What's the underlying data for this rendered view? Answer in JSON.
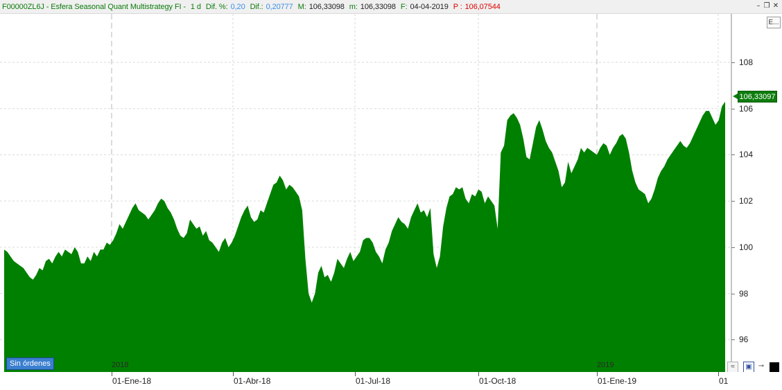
{
  "title_bar": {
    "instrument": "F00000ZL6J - Esfera Seasonal Quant Multistrategy FI -",
    "period": "1 d",
    "dif_pct_label": "Dif. %:",
    "dif_pct_value": "0,20",
    "dif_label": "Dif.:",
    "dif_value": "0,20777",
    "max_label": "M:",
    "max_value": "106,33098",
    "min_label": "m:",
    "min_value": "106,33098",
    "date_label": "F:",
    "date_value": "04-04-2019",
    "p_label": "P :",
    "p_value": "106,07544"
  },
  "window_controls": {
    "minimize": "–",
    "restore": "❐",
    "close": "✕"
  },
  "last_price": "106,33097",
  "orders_badge": "Sin órdenes",
  "e_button": "E...",
  "year_labels": [
    "2018",
    "2019"
  ],
  "colors": {
    "area": "#008000",
    "grid": "#d0d0d0",
    "price_tag": "#0d7d0d"
  },
  "chart_data": {
    "type": "area",
    "x_ticks": [
      "01-Ene-18",
      "01-Abr-18",
      "01-Jul-18",
      "01-Oct-18",
      "01-Ene-19",
      "01"
    ],
    "y_ticks": [
      96,
      98,
      100,
      102,
      104,
      106,
      108
    ],
    "ylim": [
      94.6,
      110.1
    ],
    "grid": true,
    "series": [
      {
        "values": [
          99.9,
          99.8,
          99.6,
          99.4,
          99.3,
          99.2,
          99.1,
          98.9,
          98.7,
          98.6,
          98.8,
          99.1,
          99.0,
          99.4,
          99.5,
          99.3,
          99.6,
          99.8,
          99.6,
          99.9,
          99.8,
          99.7,
          100.0,
          99.8,
          99.3,
          99.3,
          99.6,
          99.4,
          99.8,
          99.6,
          99.9,
          99.9,
          100.2,
          100.1,
          100.3,
          100.6,
          101.0,
          100.8,
          101.1,
          101.4,
          101.7,
          101.9,
          101.6,
          101.5,
          101.4,
          101.2,
          101.4,
          101.6,
          101.9,
          102.1,
          102.0,
          101.7,
          101.5,
          101.2,
          100.8,
          100.5,
          100.4,
          100.6,
          101.2,
          101.0,
          100.8,
          100.9,
          100.5,
          100.7,
          100.3,
          100.2,
          100.0,
          99.8,
          100.2,
          100.4,
          100.0,
          100.2,
          100.5,
          100.9,
          101.3,
          101.6,
          101.8,
          101.3,
          101.1,
          101.2,
          101.6,
          101.5,
          101.9,
          102.3,
          102.7,
          102.8,
          103.1,
          102.9,
          102.5,
          102.7,
          102.6,
          102.4,
          102.2,
          101.6,
          99.5,
          98.0,
          97.6,
          98.0,
          98.9,
          99.2,
          98.7,
          98.8,
          98.5,
          98.9,
          99.5,
          99.3,
          99.1,
          99.5,
          99.8,
          99.4,
          99.6,
          99.8,
          100.3,
          100.4,
          100.4,
          100.2,
          99.8,
          99.6,
          99.3,
          99.9,
          100.2,
          100.7,
          101.0,
          101.3,
          101.1,
          101.0,
          100.8,
          101.3,
          101.6,
          101.9,
          101.5,
          101.6,
          101.3,
          101.7,
          99.7,
          99.1,
          99.6,
          100.9,
          101.7,
          102.2,
          102.3,
          102.6,
          102.5,
          102.6,
          102.1,
          101.9,
          102.3,
          102.2,
          102.5,
          102.4,
          101.9,
          102.2,
          102.0,
          101.8,
          100.8,
          104.1,
          104.4,
          105.5,
          105.7,
          105.8,
          105.6,
          105.3,
          104.7,
          103.9,
          103.8,
          104.5,
          105.2,
          105.5,
          105.1,
          104.6,
          104.3,
          104.1,
          103.7,
          103.3,
          102.6,
          102.8,
          103.7,
          103.2,
          103.5,
          103.8,
          104.3,
          104.1,
          104.3,
          104.2,
          104.1,
          104.0,
          104.3,
          104.5,
          104.4,
          104.0,
          104.3,
          104.5,
          104.8,
          104.9,
          104.7,
          104.1,
          103.3,
          102.8,
          102.5,
          102.4,
          102.3,
          101.9,
          102.1,
          102.5,
          103.0,
          103.3,
          103.5,
          103.8,
          104.0,
          104.2,
          104.4,
          104.6,
          104.4,
          104.3,
          104.5,
          104.8,
          105.1,
          105.4,
          105.7,
          105.9,
          105.9,
          105.6,
          105.3,
          105.5,
          106.1,
          106.3
        ]
      }
    ]
  }
}
